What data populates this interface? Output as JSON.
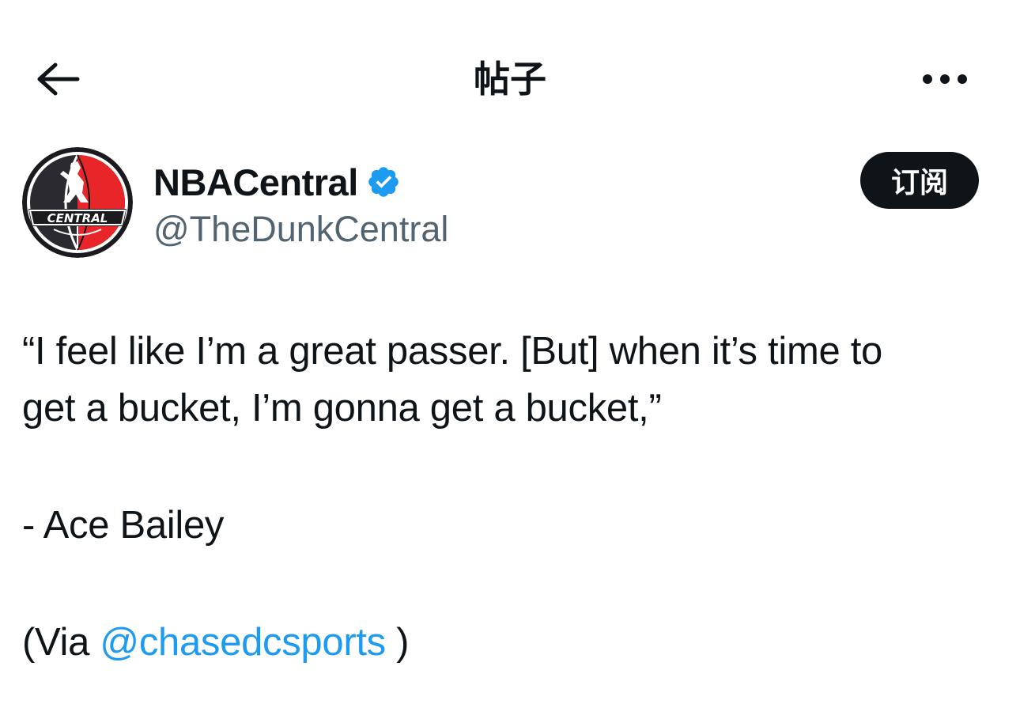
{
  "header": {
    "title": "帖子",
    "back_icon": "arrow-left-icon",
    "more_icon": "more-horizontal-icon"
  },
  "author": {
    "display_name": "NBACentral",
    "handle": "@TheDunkCentral",
    "verified_icon": "verified-badge-icon",
    "avatar_text": "CENTRAL",
    "subscribe_label": "订阅"
  },
  "tweet": {
    "line1": "“I feel like I’m a great passer. [But] when it’s time to",
    "line2": "get a bucket, I’m gonna get a bucket,”",
    "attribution": "- Ace Bailey",
    "via_prefix": "(Via ",
    "via_mention": "@chasedcsports",
    "via_suffix": " )"
  },
  "colors": {
    "text": "#0f1419",
    "secondary": "#536471",
    "link": "#1d9bf0",
    "verified": "#1d9bf0",
    "button_bg": "#0f1419",
    "avatar_red": "#e8262a"
  }
}
